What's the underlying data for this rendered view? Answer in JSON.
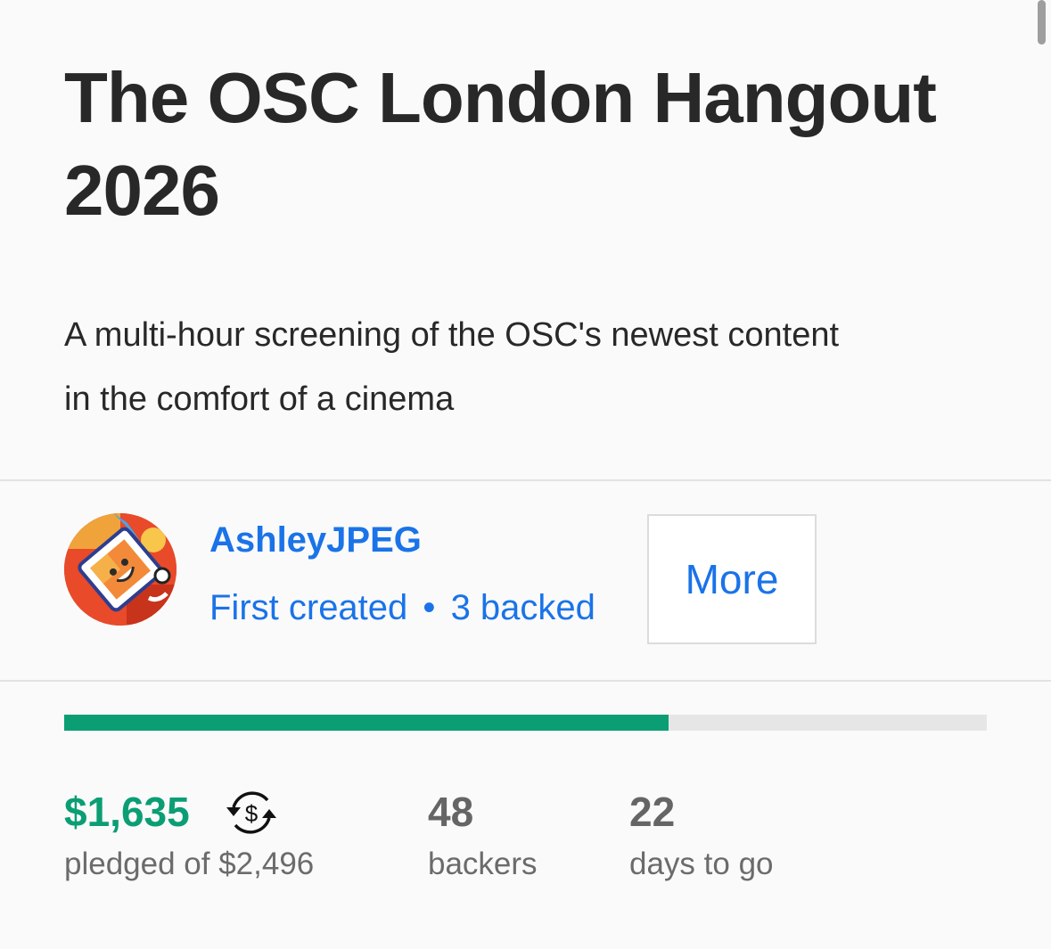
{
  "project": {
    "title_line1": "The OSC London Hangout",
    "title_line2": "2026",
    "blurb_line1": "A multi-hour screening of the OSC's newest content",
    "blurb_line2": "in the comfort of a cinema"
  },
  "creator": {
    "name": "AshleyJPEG",
    "first_created": "First created",
    "separator": "•",
    "backed": "3 backed",
    "more_label": "More"
  },
  "funding": {
    "pledged_amount": "$1,635",
    "pledged_label": "pledged of $2,496",
    "progress_fraction": 0.655,
    "backers_count": "48",
    "backers_label": "backers",
    "days_count": "22",
    "days_label": "days to go"
  },
  "colors": {
    "accent_blue": "#1a73e8",
    "funding_green": "#0b9e74",
    "progress_track": "#e6e6e6"
  },
  "icons": {
    "currency_conversion": "currency-conversion-icon",
    "avatar": "avatar"
  }
}
